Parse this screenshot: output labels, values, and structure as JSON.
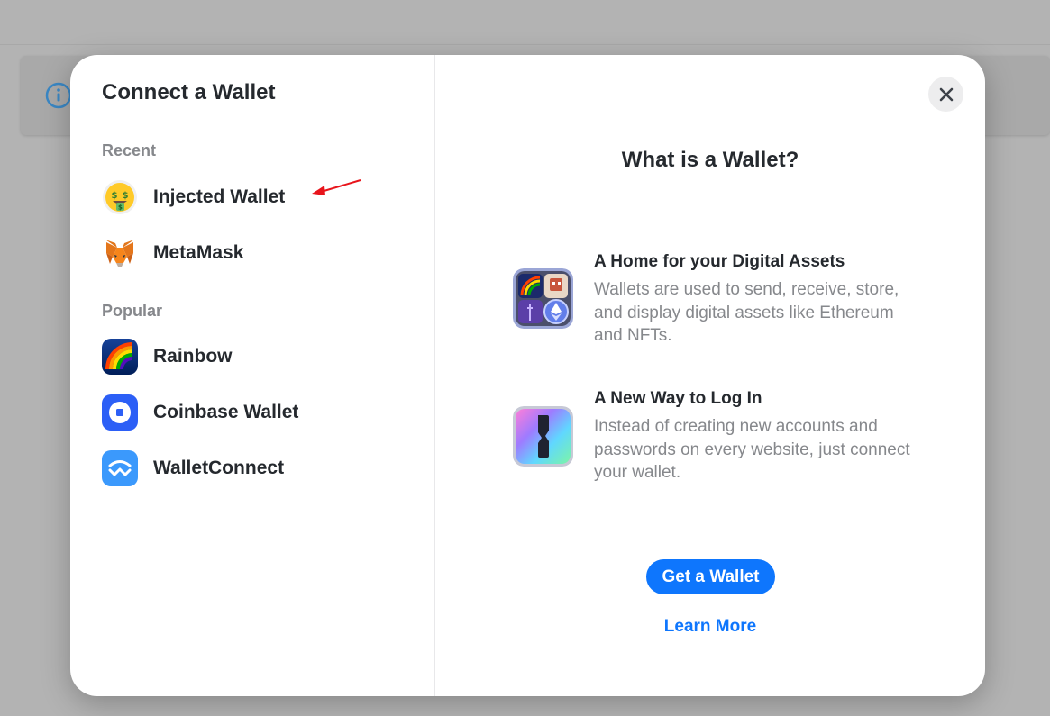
{
  "modal": {
    "title": "Connect a Wallet",
    "close_icon": "close-icon"
  },
  "sections": {
    "recent_label": "Recent",
    "popular_label": "Popular"
  },
  "wallets": {
    "recent": [
      {
        "label": "Injected Wallet",
        "icon": "money-mouth-face-icon"
      },
      {
        "label": "MetaMask",
        "icon": "metamask-fox-icon"
      }
    ],
    "popular": [
      {
        "label": "Rainbow",
        "icon": "rainbow-icon"
      },
      {
        "label": "Coinbase Wallet",
        "icon": "coinbase-icon"
      },
      {
        "label": "WalletConnect",
        "icon": "walletconnect-icon"
      }
    ]
  },
  "info": {
    "title": "What is a Wallet?",
    "features": [
      {
        "title": "A Home for your Digital Assets",
        "description": "Wallets are used to send, receive, store, and display digital assets like Ethereum and NFTs.",
        "icon": "digital-assets-icon"
      },
      {
        "title": "A New Way to Log In",
        "description": "Instead of creating new accounts and passwords on every website, just connect your wallet.",
        "icon": "login-key-icon"
      }
    ],
    "get_wallet_label": "Get a Wallet",
    "learn_more_label": "Learn More"
  },
  "colors": {
    "accent": "#0e76fd",
    "title_text": "#25292e",
    "muted_text": "#86888c",
    "annotation_arrow": "#e8141b"
  }
}
